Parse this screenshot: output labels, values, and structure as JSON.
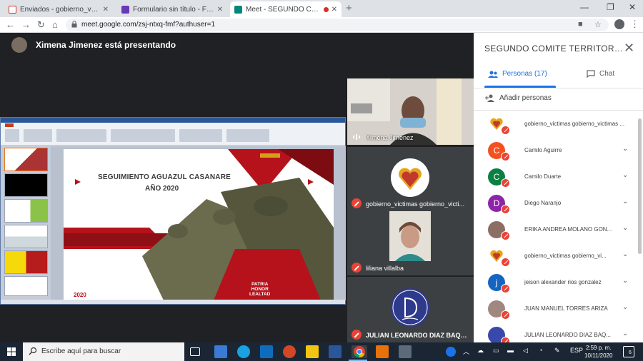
{
  "browser": {
    "tabs": [
      {
        "label": "Enviados - gobierno_victimas@e",
        "favicon_color": "#d93025",
        "active": false
      },
      {
        "label": "Formulario sin título - Formulario",
        "favicon_color": "#673ab7",
        "active": false
      },
      {
        "label": "Meet - SEGUNDO COMITE T",
        "favicon_color": "#00897b",
        "active": true
      }
    ],
    "new_tab": "+",
    "window_controls": {
      "minimize": "—",
      "restore": "❐",
      "close": "✕"
    },
    "nav": {
      "back": "←",
      "forward": "→",
      "reload": "↻",
      "home": "⌂"
    },
    "url": "meet.google.com/zsj-ntxq-fmf?authuser=1",
    "menu": "⋮"
  },
  "meet": {
    "presenter_banner": "Ximena Jimenez está presentando",
    "slide": {
      "title_line1": "SEGUIMIENTO AGUAZUL CASANARE",
      "title_line2": "AÑO 2020",
      "motto": [
        "PATRIA",
        "HONOR",
        "LEALTAD"
      ],
      "footer_year": "2020"
    },
    "tiles": [
      {
        "name": "Ximena Jimenez",
        "mic": "on"
      },
      {
        "name": "gobierno_victimas gobierno_victi...",
        "mic": "off"
      },
      {
        "name": "liliana villalba",
        "mic": "off"
      },
      {
        "name": "JULIAN LEONARDO DIAZ BAQUE...",
        "mic": "off"
      }
    ]
  },
  "panel": {
    "title": "SEGUNDO COMITE TERRITORIAL ...",
    "close": "✕",
    "tab_people": "Personas (17)",
    "tab_chat": "Chat",
    "add_people": "Añadir personas",
    "participants": [
      {
        "name": "gobierno_victimas gobierno_victimas ...",
        "initial": "",
        "avatar_color": "#ffffff",
        "chevron": false
      },
      {
        "name": "Camilo Aguirre",
        "initial": "C",
        "avatar_color": "#f4511e",
        "chevron": true
      },
      {
        "name": "Camilo Duarte",
        "initial": "C",
        "avatar_color": "#0b8043",
        "chevron": true
      },
      {
        "name": "Diego Naranjo",
        "initial": "D",
        "avatar_color": "#8e24aa",
        "chevron": true
      },
      {
        "name": "ERIKA ANDREA MOLANO GON...",
        "initial": "",
        "avatar_color": "#8d6e63",
        "chevron": true
      },
      {
        "name": "gobierno_victimas gobierno_vi...",
        "initial": "",
        "avatar_color": "#ffffff",
        "chevron": true
      },
      {
        "name": "jeison alexander rios gonzalez",
        "initial": "j",
        "avatar_color": "#1565c0",
        "chevron": true
      },
      {
        "name": "JUAN MANUEL TORRES ARIZA",
        "initial": "",
        "avatar_color": "#a1887f",
        "chevron": true
      },
      {
        "name": "JULIAN LEONARDO DIAZ BAQ...",
        "initial": "",
        "avatar_color": "#3949ab",
        "chevron": true
      }
    ]
  },
  "taskbar": {
    "search_placeholder": "Escribe aquí para buscar",
    "language": "ESP",
    "time": "2:59 p. m.",
    "date": "10/11/2020",
    "notifications": "6"
  }
}
